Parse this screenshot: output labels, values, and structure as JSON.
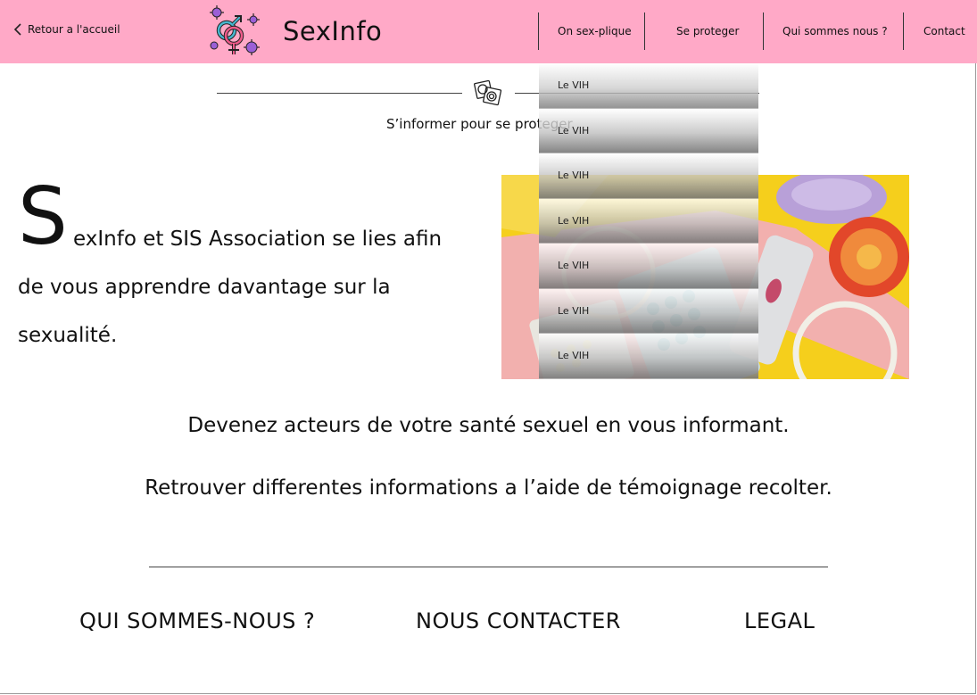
{
  "header": {
    "back_label": "Retour a l'accueil",
    "brand": "SexInfo",
    "nav": [
      {
        "label": "On sex-plique"
      },
      {
        "label": "Se proteger"
      },
      {
        "label": "Qui sommes nous ?"
      },
      {
        "label": "Contact"
      }
    ]
  },
  "dropdown": {
    "items": [
      {
        "label": "Le VIH"
      },
      {
        "label": "Le VIH"
      },
      {
        "label": "Le VIH"
      },
      {
        "label": "Le VIH"
      },
      {
        "label": "Le VIH"
      },
      {
        "label": "Le VIH"
      },
      {
        "label": "Le VIH"
      }
    ]
  },
  "section": {
    "tagline": "S’informer pour se proteger"
  },
  "intro": {
    "drop_cap": "S",
    "line1": "exInfo et SIS Association se lies afin",
    "line2": "de vous apprendre davantage sur la",
    "line3": "sexualité."
  },
  "body": {
    "line1": "Devenez acteurs de votre santé sexuel en vous informant.",
    "line2": "Retrouver differentes informations a l’aide de témoignage recolter."
  },
  "footer": {
    "links": [
      {
        "label": "QUI SOMMES-NOUS ?"
      },
      {
        "label": "NOUS CONTACTER"
      },
      {
        "label": "LEGAL"
      }
    ]
  },
  "colors": {
    "header_bg": "#ffa9c7",
    "photo_yellow": "#f5cf1c",
    "photo_pink": "#f2b0ae"
  }
}
